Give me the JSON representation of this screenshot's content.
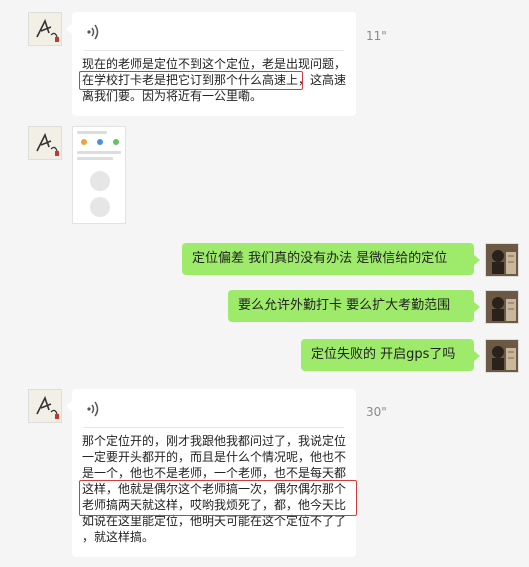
{
  "messages": [
    {
      "id": "msg1",
      "type": "voice",
      "direction": "incoming",
      "duration": "11\"",
      "transcript_lines": [
        "现在的老师是定位不到这个定位，老是出现问题，",
        "在学校打卡老是把它订到那个什么高速上，这高速",
        "离我们要。因为将近有一公里嘞。"
      ]
    },
    {
      "id": "msg2",
      "type": "image",
      "direction": "incoming"
    },
    {
      "id": "msg3",
      "type": "text",
      "direction": "outgoing",
      "text": "定位偏差 我们真的没有办法 是微信给的定位"
    },
    {
      "id": "msg4",
      "type": "text",
      "direction": "outgoing",
      "text": "要么允许外勤打卡 要么扩大考勤范围"
    },
    {
      "id": "msg5",
      "type": "text",
      "direction": "outgoing",
      "text": "定位失败的 开启gps了吗"
    },
    {
      "id": "msg6",
      "type": "voice",
      "direction": "incoming",
      "duration": "30\"",
      "transcript_lines": [
        "那个定位开的，刚才我跟他我都问过了，我说定位",
        "一定要开头都开的，而且是什么个情况呢，他也不",
        "是一个，他也不是老师，一个老师，也不是每天都",
        "这样，他就是偶尔这个老师搞一次，偶尔偶尔那个",
        "老师搞两天就这样，哎哟我烦死了，都，他今天比",
        "如说在这里能定位，他明天可能在这个定位不了了",
        "，就这样搞。"
      ]
    }
  ]
}
